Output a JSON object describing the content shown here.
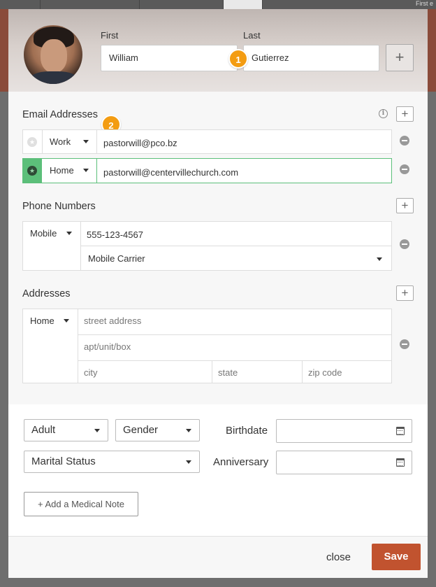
{
  "background": {
    "corner_text": "First e"
  },
  "header": {
    "first_label": "First",
    "last_label": "Last",
    "first_value": "William",
    "last_value": "Gutierrez",
    "add_name_icon": "plus-icon"
  },
  "badges": {
    "step1": "1",
    "step2": "2"
  },
  "email": {
    "title": "Email Addresses",
    "rows": [
      {
        "type": "Work",
        "value": "pastorwill@pco.bz",
        "primary": false
      },
      {
        "type": "Home",
        "value": "pastorwill@centervillechurch.com",
        "primary": true
      }
    ]
  },
  "phone": {
    "title": "Phone Numbers",
    "type": "Mobile",
    "value": "555-123-4567",
    "carrier": "Mobile Carrier"
  },
  "addresses": {
    "title": "Addresses",
    "type": "Home",
    "street_placeholder": "street address",
    "apt_placeholder": "apt/unit/box",
    "city_placeholder": "city",
    "state_placeholder": "state",
    "zip_placeholder": "zip code"
  },
  "details": {
    "age_group": "Adult",
    "gender": "Gender",
    "marital_status": "Marital Status",
    "birthdate_label": "Birthdate",
    "anniversary_label": "Anniversary",
    "medical_note_button": "+ Add a Medical Note"
  },
  "footer": {
    "close_label": "close",
    "save_label": "Save"
  },
  "colors": {
    "accent": "#c1532f",
    "badge": "#f39c12",
    "primary_green": "#5cbf7a"
  }
}
